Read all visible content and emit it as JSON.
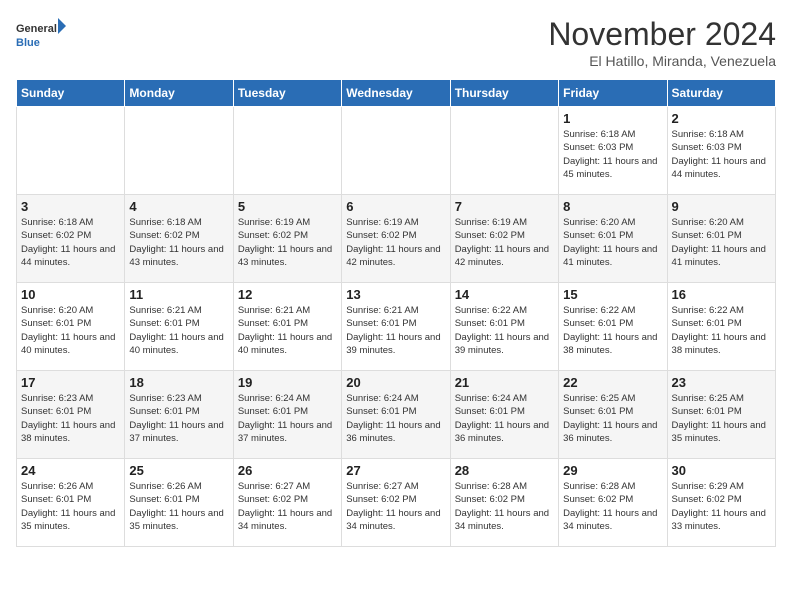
{
  "logo": {
    "line1": "General",
    "line2": "Blue"
  },
  "title": "November 2024",
  "subtitle": "El Hatillo, Miranda, Venezuela",
  "weekdays": [
    "Sunday",
    "Monday",
    "Tuesday",
    "Wednesday",
    "Thursday",
    "Friday",
    "Saturday"
  ],
  "weeks": [
    [
      {
        "day": "",
        "sunrise": "",
        "sunset": "",
        "daylight": ""
      },
      {
        "day": "",
        "sunrise": "",
        "sunset": "",
        "daylight": ""
      },
      {
        "day": "",
        "sunrise": "",
        "sunset": "",
        "daylight": ""
      },
      {
        "day": "",
        "sunrise": "",
        "sunset": "",
        "daylight": ""
      },
      {
        "day": "",
        "sunrise": "",
        "sunset": "",
        "daylight": ""
      },
      {
        "day": "1",
        "sunrise": "Sunrise: 6:18 AM",
        "sunset": "Sunset: 6:03 PM",
        "daylight": "Daylight: 11 hours and 45 minutes."
      },
      {
        "day": "2",
        "sunrise": "Sunrise: 6:18 AM",
        "sunset": "Sunset: 6:03 PM",
        "daylight": "Daylight: 11 hours and 44 minutes."
      }
    ],
    [
      {
        "day": "3",
        "sunrise": "Sunrise: 6:18 AM",
        "sunset": "Sunset: 6:02 PM",
        "daylight": "Daylight: 11 hours and 44 minutes."
      },
      {
        "day": "4",
        "sunrise": "Sunrise: 6:18 AM",
        "sunset": "Sunset: 6:02 PM",
        "daylight": "Daylight: 11 hours and 43 minutes."
      },
      {
        "day": "5",
        "sunrise": "Sunrise: 6:19 AM",
        "sunset": "Sunset: 6:02 PM",
        "daylight": "Daylight: 11 hours and 43 minutes."
      },
      {
        "day": "6",
        "sunrise": "Sunrise: 6:19 AM",
        "sunset": "Sunset: 6:02 PM",
        "daylight": "Daylight: 11 hours and 42 minutes."
      },
      {
        "day": "7",
        "sunrise": "Sunrise: 6:19 AM",
        "sunset": "Sunset: 6:02 PM",
        "daylight": "Daylight: 11 hours and 42 minutes."
      },
      {
        "day": "8",
        "sunrise": "Sunrise: 6:20 AM",
        "sunset": "Sunset: 6:01 PM",
        "daylight": "Daylight: 11 hours and 41 minutes."
      },
      {
        "day": "9",
        "sunrise": "Sunrise: 6:20 AM",
        "sunset": "Sunset: 6:01 PM",
        "daylight": "Daylight: 11 hours and 41 minutes."
      }
    ],
    [
      {
        "day": "10",
        "sunrise": "Sunrise: 6:20 AM",
        "sunset": "Sunset: 6:01 PM",
        "daylight": "Daylight: 11 hours and 40 minutes."
      },
      {
        "day": "11",
        "sunrise": "Sunrise: 6:21 AM",
        "sunset": "Sunset: 6:01 PM",
        "daylight": "Daylight: 11 hours and 40 minutes."
      },
      {
        "day": "12",
        "sunrise": "Sunrise: 6:21 AM",
        "sunset": "Sunset: 6:01 PM",
        "daylight": "Daylight: 11 hours and 40 minutes."
      },
      {
        "day": "13",
        "sunrise": "Sunrise: 6:21 AM",
        "sunset": "Sunset: 6:01 PM",
        "daylight": "Daylight: 11 hours and 39 minutes."
      },
      {
        "day": "14",
        "sunrise": "Sunrise: 6:22 AM",
        "sunset": "Sunset: 6:01 PM",
        "daylight": "Daylight: 11 hours and 39 minutes."
      },
      {
        "day": "15",
        "sunrise": "Sunrise: 6:22 AM",
        "sunset": "Sunset: 6:01 PM",
        "daylight": "Daylight: 11 hours and 38 minutes."
      },
      {
        "day": "16",
        "sunrise": "Sunrise: 6:22 AM",
        "sunset": "Sunset: 6:01 PM",
        "daylight": "Daylight: 11 hours and 38 minutes."
      }
    ],
    [
      {
        "day": "17",
        "sunrise": "Sunrise: 6:23 AM",
        "sunset": "Sunset: 6:01 PM",
        "daylight": "Daylight: 11 hours and 38 minutes."
      },
      {
        "day": "18",
        "sunrise": "Sunrise: 6:23 AM",
        "sunset": "Sunset: 6:01 PM",
        "daylight": "Daylight: 11 hours and 37 minutes."
      },
      {
        "day": "19",
        "sunrise": "Sunrise: 6:24 AM",
        "sunset": "Sunset: 6:01 PM",
        "daylight": "Daylight: 11 hours and 37 minutes."
      },
      {
        "day": "20",
        "sunrise": "Sunrise: 6:24 AM",
        "sunset": "Sunset: 6:01 PM",
        "daylight": "Daylight: 11 hours and 36 minutes."
      },
      {
        "day": "21",
        "sunrise": "Sunrise: 6:24 AM",
        "sunset": "Sunset: 6:01 PM",
        "daylight": "Daylight: 11 hours and 36 minutes."
      },
      {
        "day": "22",
        "sunrise": "Sunrise: 6:25 AM",
        "sunset": "Sunset: 6:01 PM",
        "daylight": "Daylight: 11 hours and 36 minutes."
      },
      {
        "day": "23",
        "sunrise": "Sunrise: 6:25 AM",
        "sunset": "Sunset: 6:01 PM",
        "daylight": "Daylight: 11 hours and 35 minutes."
      }
    ],
    [
      {
        "day": "24",
        "sunrise": "Sunrise: 6:26 AM",
        "sunset": "Sunset: 6:01 PM",
        "daylight": "Daylight: 11 hours and 35 minutes."
      },
      {
        "day": "25",
        "sunrise": "Sunrise: 6:26 AM",
        "sunset": "Sunset: 6:01 PM",
        "daylight": "Daylight: 11 hours and 35 minutes."
      },
      {
        "day": "26",
        "sunrise": "Sunrise: 6:27 AM",
        "sunset": "Sunset: 6:02 PM",
        "daylight": "Daylight: 11 hours and 34 minutes."
      },
      {
        "day": "27",
        "sunrise": "Sunrise: 6:27 AM",
        "sunset": "Sunset: 6:02 PM",
        "daylight": "Daylight: 11 hours and 34 minutes."
      },
      {
        "day": "28",
        "sunrise": "Sunrise: 6:28 AM",
        "sunset": "Sunset: 6:02 PM",
        "daylight": "Daylight: 11 hours and 34 minutes."
      },
      {
        "day": "29",
        "sunrise": "Sunrise: 6:28 AM",
        "sunset": "Sunset: 6:02 PM",
        "daylight": "Daylight: 11 hours and 34 minutes."
      },
      {
        "day": "30",
        "sunrise": "Sunrise: 6:29 AM",
        "sunset": "Sunset: 6:02 PM",
        "daylight": "Daylight: 11 hours and 33 minutes."
      }
    ]
  ]
}
